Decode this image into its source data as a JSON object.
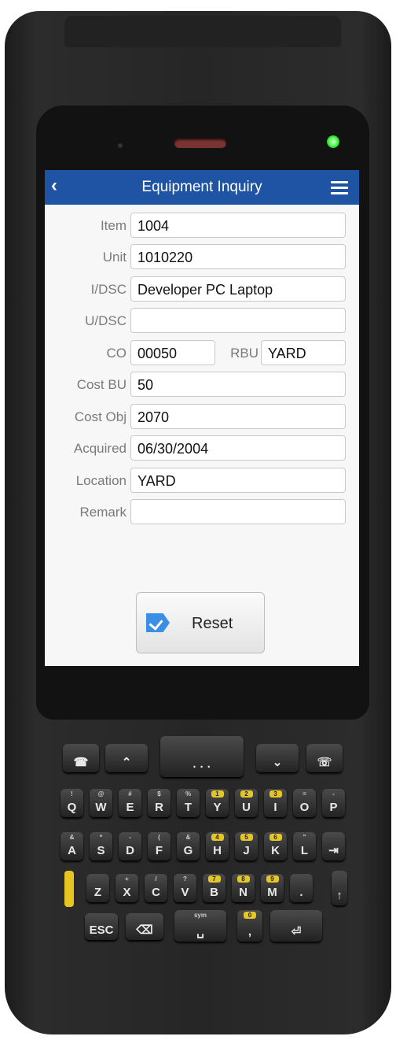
{
  "app": {
    "title": "Equipment Inquiry",
    "back_icon": "chevron-left-icon",
    "menu_icon": "hamburger-menu-icon",
    "header_color": "#1f53a3"
  },
  "form": {
    "item": {
      "label": "Item",
      "value": "1004"
    },
    "unit": {
      "label": "Unit",
      "value": "1010220"
    },
    "idsc": {
      "label": "I/DSC",
      "value": "Developer PC Laptop"
    },
    "udsc": {
      "label": "U/DSC",
      "value": ""
    },
    "co": {
      "label": "CO",
      "value": "00050"
    },
    "rbu": {
      "label": "RBU",
      "value": "YARD"
    },
    "cost_bu": {
      "label": "Cost BU",
      "value": "50"
    },
    "cost_obj": {
      "label": "Cost Obj",
      "value": "2070"
    },
    "acquired": {
      "label": "Acquired",
      "value": "06/30/2004"
    },
    "location": {
      "label": "Location",
      "value": "YARD"
    },
    "remark": {
      "label": "Remark",
      "value": ""
    }
  },
  "buttons": {
    "reset_label": "Reset",
    "reset_icon": "checkmark-arrow-icon"
  },
  "keypad": {
    "row1": [
      "Q",
      "W",
      "E",
      "R",
      "T",
      "Y",
      "U",
      "I",
      "O",
      "P"
    ],
    "row1_sub": [
      "!",
      "@",
      "#",
      "$",
      "%",
      "1",
      "2",
      "3",
      "=",
      "-"
    ],
    "row2": [
      "A",
      "S",
      "D",
      "F",
      "G",
      "H",
      "J",
      "K",
      "L",
      "⇥"
    ],
    "row2_sub": [
      "&",
      "*",
      "-",
      "(",
      "&",
      "4",
      "5",
      "6",
      "\"",
      ""
    ],
    "row3": [
      "Z",
      "X",
      "C",
      "V",
      "B",
      "N",
      "M",
      "."
    ],
    "row3_sub": [
      "",
      "+",
      "/",
      "?",
      "7",
      "8",
      "9",
      ""
    ],
    "bottom": {
      "esc": "ESC",
      "sym": "sym",
      "zero": "0"
    }
  }
}
